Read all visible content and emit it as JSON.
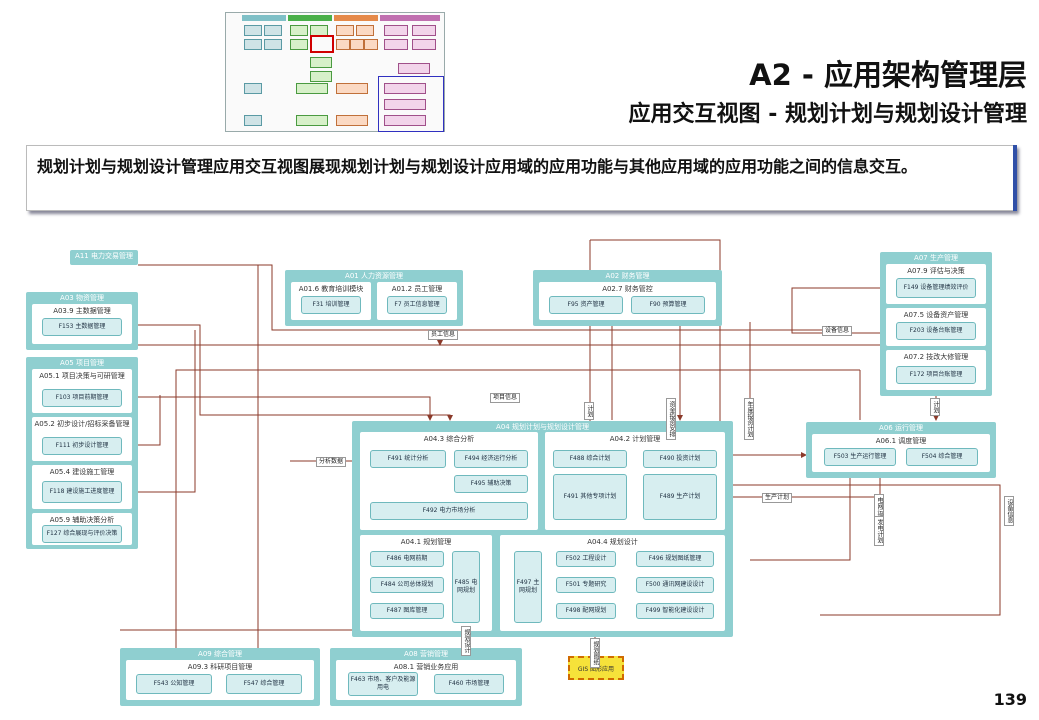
{
  "header": {
    "title": "A2 - 应用架构管理层",
    "subtitle": "应用交互视图 - 规划计划与规划设计管理"
  },
  "description": "规划计划与规划设计管理应用交互视图展现规划计划与规划设计应用域的应用功能与其他应用域的应用功能之间的信息交互。",
  "page_number": "139",
  "colors": {
    "group": "#8fcfd0",
    "func": "#d7eef0",
    "link": "#8b3a2a",
    "highlight": "#d00000"
  },
  "groups": {
    "a11": {
      "title": "A11 电力交易管理"
    },
    "a03": {
      "title": "A03 物资管理",
      "s1": "A03.9 主数据管理",
      "f1": "F153 主数据管理"
    },
    "a05": {
      "title": "A05 项目管理",
      "s1": "A05.1 项目决策与可研管理",
      "f1": "F103 项目前期管理",
      "s2": "A05.2 初步设计/招标采备管理",
      "f2": "F111 初步设计管理",
      "s3": "A05.4 建设施工管理",
      "f3": "F118 建设施工进度管理",
      "s4": "A05.9 辅助决策分析",
      "f4": "F127 综合展现与评价决策"
    },
    "a01": {
      "title": "A01 人力资源管理",
      "s1": "A01.6 教育培训模块",
      "f1": "F31 培训管理",
      "s2": "A01.2 员工管理",
      "f2": "F7 员工信息管理"
    },
    "a02": {
      "title": "A02 财务管理",
      "s1": "A02.7 财务管控",
      "f1": "F95 资产管理",
      "f2": "F90 预算管理"
    },
    "a07": {
      "title": "A07 生产管理",
      "s1": "A07.9 评估与决策",
      "f1": "F149 设备管理绩效评价",
      "s2": "A07.5 设备资产管理",
      "f2": "F203 设备台账管理",
      "s3": "A07.2 技改大修管理",
      "f3": "F172 项目台账管理"
    },
    "a06": {
      "title": "A06 运行管理",
      "s1": "A06.1 调度管理",
      "f1": "F503 生产运行管理",
      "f2": "F504 综合管理"
    },
    "a04": {
      "title": "A04 规划计划与规划设计管理",
      "s1": "A04.3 综合分析",
      "f1": "F491 统计分析",
      "f2": "F494 经济运行分析",
      "f3": "F495 辅助决策",
      "f4": "F492 电力市场分析",
      "s2": "A04.2 计划管理",
      "f5": "F488 综合计划",
      "f6": "F490 投资计划",
      "f7": "F491 其他专项计划",
      "f8": "F489 生产计划",
      "s3": "A04.1 规划管理",
      "f9": "F486 电网前期",
      "f10": "F484 公司总体规划",
      "f11": "F487 图库管理",
      "f12": "F485 电网规划",
      "s4": "A04.4 规划设计",
      "f13": "F497 主网规划",
      "f14": "F502 工程设计",
      "f15": "F496 规划图纸管理",
      "f16": "F501 专题研究",
      "f17": "F500 通讯网建设设计",
      "f18": "F498 配网规划",
      "f19": "F499 智能化建设设计"
    },
    "a09": {
      "title": "A09 综合管理",
      "s1": "A09.3 科研项目管理",
      "f1": "F543 公知管理",
      "f2": "F547 综合管理"
    },
    "a08": {
      "title": "A08 营销管理",
      "s1": "A08.1 营销业务应用",
      "f1": "F463 市场、客户及能源用电",
      "f2": "F460 市场管理"
    },
    "ext": {
      "label": "GIS 图形应用"
    }
  },
  "links": {
    "l1": "员工信息",
    "l2": "设备信息",
    "l3": "项目信息",
    "l4": "分析数据",
    "l5": "计划",
    "l6": "资金投资安排",
    "l7": "年度投资计划",
    "l8": "计划",
    "l9": "生产计划",
    "l10": "电网运行",
    "l11": "发电计划",
    "l12": "设备信息",
    "l13": "规划设计",
    "l14": "规划图纸"
  }
}
